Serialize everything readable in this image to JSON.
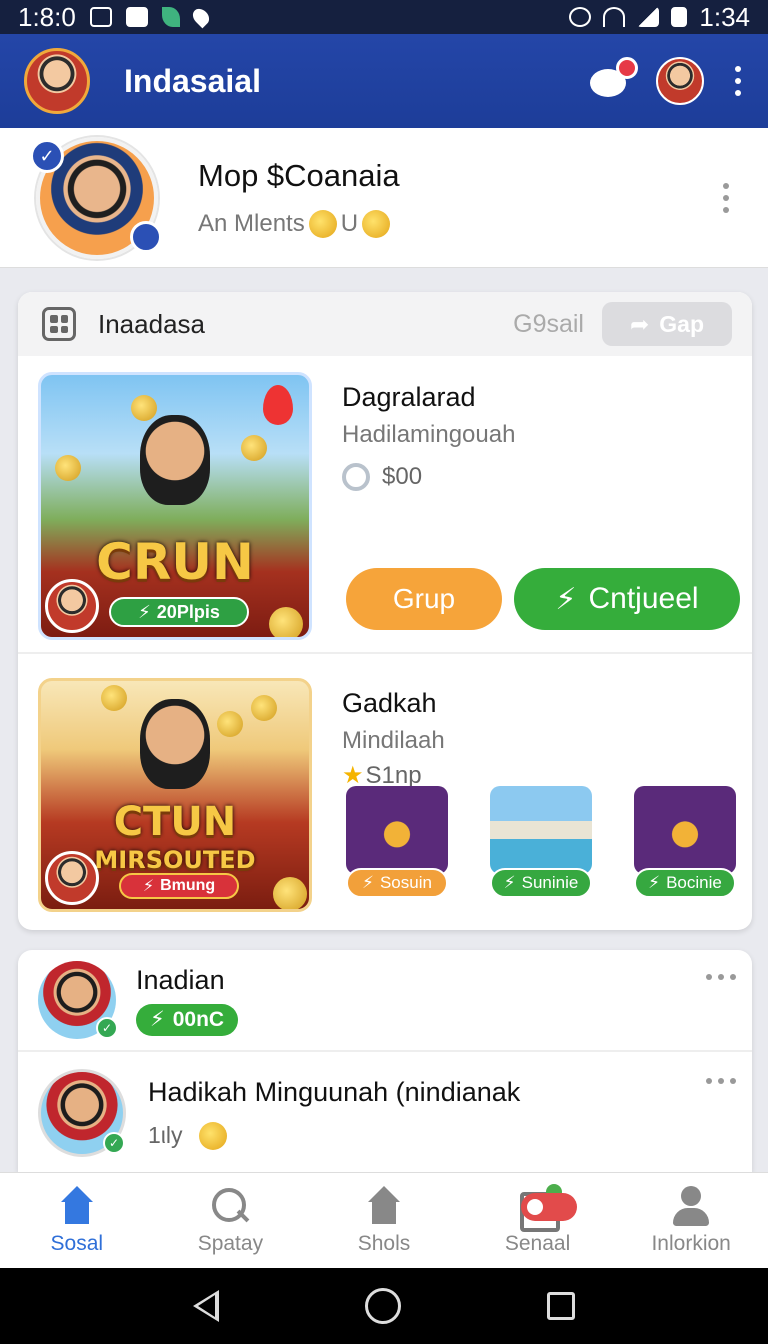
{
  "status_bar": {
    "time_left": "1:8:0",
    "time_right": "1:34",
    "icons": [
      "sim-icon",
      "camera-icon",
      "leaf-icon",
      "location-icon",
      "alarm-icon",
      "wifi-icon",
      "signal-icon",
      "battery-icon"
    ]
  },
  "app_bar": {
    "title": "Indasaial"
  },
  "profile": {
    "name": "Mop $Coanaia",
    "subtitle": "An Mlents",
    "subtitle_suffix": "U"
  },
  "feed": {
    "title": "Inaadasa",
    "link": "G9sail",
    "link_button": "Gap",
    "posts": [
      {
        "title": "Dagralarad",
        "subtitle": "Hadilamingouah",
        "price": "$00",
        "thumb_word": "CRUN",
        "thumb_pill": "20Plpis",
        "btn_orange": "Grup",
        "btn_green": "Cntjueel"
      },
      {
        "title": "Gadkah",
        "subtitle": "Mindilaah",
        "price": "S1np",
        "thumb_word": "CTUN",
        "thumb_word2": "MIRSOUTED",
        "thumb_pill": "Bmung",
        "tiles": [
          "Sosuin",
          "Suninie",
          "Bocinie"
        ]
      }
    ]
  },
  "list": [
    {
      "name": "Inadian",
      "badge": "00nC"
    },
    {
      "name": "Hadikah Minguunah (nindianak",
      "sub": "1ιly"
    }
  ],
  "bottom_nav": [
    {
      "label": "Sosal",
      "icon": "home-icon",
      "active": true
    },
    {
      "label": "Spatay",
      "icon": "search-icon",
      "active": false
    },
    {
      "label": "Shols",
      "icon": "shop-icon",
      "active": false
    },
    {
      "label": "Senaal",
      "icon": "edit-icon",
      "active": false
    },
    {
      "label": "Inlorkion",
      "icon": "profile-icon",
      "active": false
    }
  ],
  "colors": {
    "app_bar": "#1d3d99",
    "accent_green": "#35ad3b",
    "accent_orange": "#f6a43a",
    "nav_active": "#2f6fd8"
  }
}
